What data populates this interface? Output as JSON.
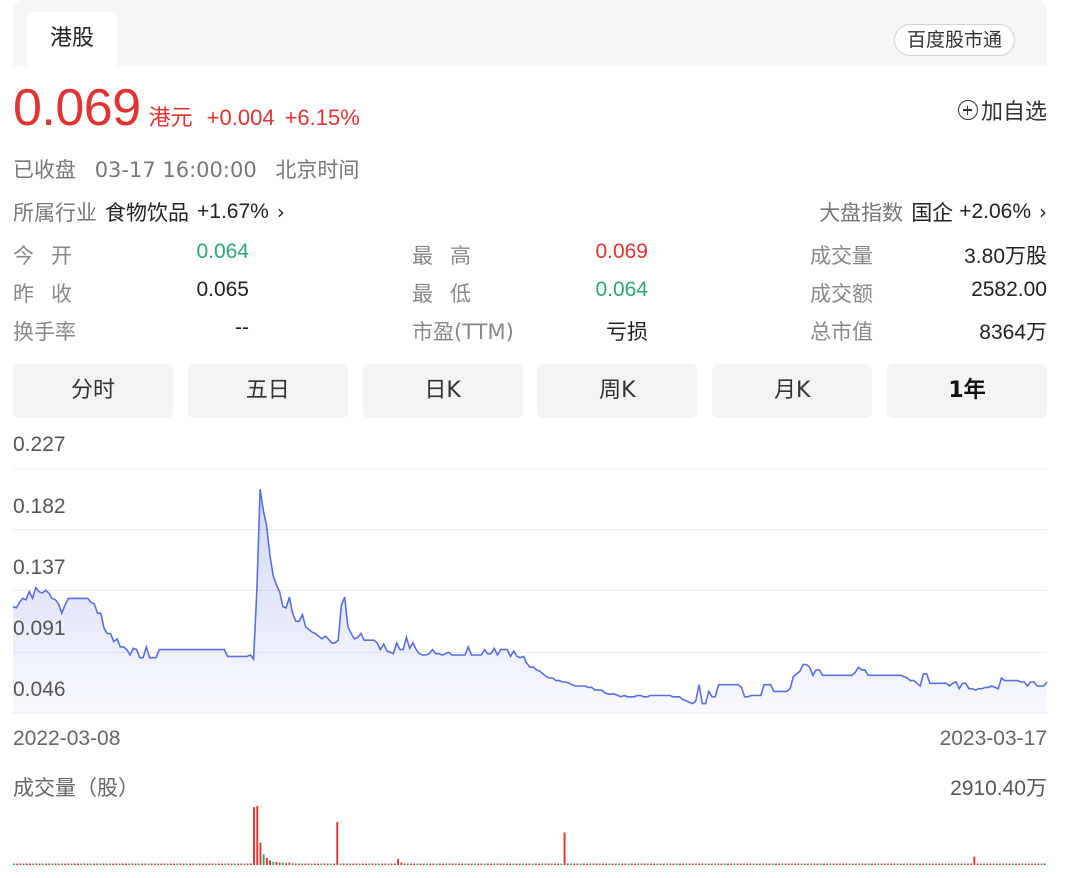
{
  "header": {
    "tab_label": "港股",
    "badge": "百度股市通"
  },
  "quote": {
    "price": "0.069",
    "currency": "港元",
    "change": "+0.004",
    "change_pct": "+6.15%",
    "add_favorite": "加自选",
    "status": "已收盘",
    "datetime": "03-17 16:00:00",
    "timezone": "北京时间"
  },
  "industry": {
    "label": "所属行业",
    "name": "食物饮品",
    "change": "+1.67%"
  },
  "index": {
    "label": "大盘指数",
    "name": "国企",
    "change": "+2.06%"
  },
  "stats": {
    "open": {
      "label": "今开",
      "value": "0.064"
    },
    "high": {
      "label": "最高",
      "value": "0.069"
    },
    "volume": {
      "label": "成交量",
      "value": "3.80万股"
    },
    "prev_close": {
      "label": "昨收",
      "value": "0.065"
    },
    "low": {
      "label": "最低",
      "value": "0.064"
    },
    "turnover": {
      "label": "成交额",
      "value": "2582.00"
    },
    "turnover_rate": {
      "label": "换手率",
      "value": "--"
    },
    "pe": {
      "label": "市盈(TTM)",
      "value": "亏损"
    },
    "market_cap": {
      "label": "总市值",
      "value": "8364万"
    }
  },
  "periods": [
    "分时",
    "五日",
    "日K",
    "周K",
    "月K",
    "1年"
  ],
  "active_period": "1年",
  "colors": {
    "up": "#e33232",
    "down": "#2aa872",
    "line": "#5b6ee1",
    "fill": "#e9ecfb"
  },
  "chart_data": [
    {
      "type": "area",
      "title": "",
      "x_start": "2022-03-08",
      "x_end": "2023-03-17",
      "x_labels": [
        "2022-03-08",
        "2023-03-17"
      ],
      "y_ticks": [
        "0.227",
        "0.182",
        "0.137",
        "0.091",
        "0.046"
      ],
      "ylim": [
        0.046,
        0.227
      ],
      "grid": true,
      "series": [
        {
          "values": [
            0.125,
            0.124,
            0.128,
            0.131,
            0.13,
            0.136,
            0.131,
            0.139,
            0.136,
            0.135,
            0.137,
            0.135,
            0.131,
            0.13,
            0.127,
            0.12,
            0.126,
            0.131,
            0.131,
            0.131,
            0.131,
            0.131,
            0.131,
            0.131,
            0.128,
            0.127,
            0.12,
            0.12,
            0.109,
            0.105,
            0.105,
            0.099,
            0.101,
            0.095,
            0.095,
            0.093,
            0.089,
            0.094,
            0.093,
            0.087,
            0.087,
            0.095,
            0.087,
            0.087,
            0.087,
            0.093,
            0.093,
            0.093,
            0.093,
            0.093,
            0.093,
            0.093,
            0.093,
            0.093,
            0.093,
            0.093,
            0.093,
            0.093,
            0.093,
            0.093,
            0.093,
            0.093,
            0.093,
            0.093,
            0.093,
            0.093,
            0.088,
            0.088,
            0.088,
            0.088,
            0.088,
            0.088,
            0.088,
            0.089,
            0.086,
            0.138,
            0.212,
            0.196,
            0.185,
            0.163,
            0.148,
            0.141,
            0.136,
            0.125,
            0.124,
            0.132,
            0.12,
            0.114,
            0.114,
            0.119,
            0.11,
            0.108,
            0.106,
            0.105,
            0.103,
            0.101,
            0.103,
            0.101,
            0.098,
            0.098,
            0.1,
            0.126,
            0.132,
            0.11,
            0.105,
            0.101,
            0.102,
            0.105,
            0.1,
            0.1,
            0.1,
            0.1,
            0.098,
            0.093,
            0.097,
            0.092,
            0.091,
            0.09,
            0.098,
            0.093,
            0.093,
            0.102,
            0.094,
            0.098,
            0.093,
            0.09,
            0.089,
            0.089,
            0.09,
            0.093,
            0.09,
            0.09,
            0.089,
            0.09,
            0.091,
            0.089,
            0.089,
            0.089,
            0.089,
            0.089,
            0.095,
            0.089,
            0.089,
            0.089,
            0.089,
            0.093,
            0.09,
            0.09,
            0.094,
            0.089,
            0.093,
            0.093,
            0.093,
            0.088,
            0.092,
            0.088,
            0.087,
            0.088,
            0.083,
            0.08,
            0.08,
            0.078,
            0.077,
            0.075,
            0.073,
            0.072,
            0.072,
            0.07,
            0.07,
            0.069,
            0.069,
            0.068,
            0.067,
            0.066,
            0.066,
            0.066,
            0.066,
            0.065,
            0.065,
            0.063,
            0.063,
            0.063,
            0.061,
            0.06,
            0.06,
            0.06,
            0.059,
            0.058,
            0.059,
            0.058,
            0.058,
            0.058,
            0.059,
            0.059,
            0.058,
            0.058,
            0.059,
            0.059,
            0.059,
            0.059,
            0.059,
            0.059,
            0.059,
            0.058,
            0.058,
            0.058,
            0.056,
            0.055,
            0.054,
            0.053,
            0.055,
            0.067,
            0.053,
            0.053,
            0.062,
            0.058,
            0.058,
            0.067,
            0.067,
            0.067,
            0.067,
            0.067,
            0.067,
            0.067,
            0.065,
            0.058,
            0.058,
            0.059,
            0.059,
            0.059,
            0.059,
            0.067,
            0.067,
            0.067,
            0.062,
            0.062,
            0.062,
            0.062,
            0.062,
            0.064,
            0.073,
            0.075,
            0.077,
            0.082,
            0.082,
            0.08,
            0.074,
            0.078,
            0.078,
            0.074,
            0.074,
            0.074,
            0.074,
            0.074,
            0.074,
            0.074,
            0.074,
            0.074,
            0.074,
            0.076,
            0.08,
            0.078,
            0.078,
            0.074,
            0.074,
            0.074,
            0.074,
            0.074,
            0.074,
            0.074,
            0.074,
            0.074,
            0.074,
            0.074,
            0.073,
            0.072,
            0.07,
            0.07,
            0.068,
            0.066,
            0.075,
            0.075,
            0.068,
            0.068,
            0.068,
            0.068,
            0.068,
            0.068,
            0.066,
            0.068,
            0.069,
            0.064,
            0.068,
            0.068,
            0.064,
            0.064,
            0.063,
            0.064,
            0.064,
            0.065,
            0.065,
            0.066,
            0.065,
            0.064,
            0.072,
            0.07,
            0.07,
            0.07,
            0.07,
            0.07,
            0.069,
            0.069,
            0.066,
            0.069,
            0.069,
            0.066,
            0.066,
            0.066,
            0.069
          ]
        }
      ]
    },
    {
      "type": "bar",
      "title": "成交量（股）",
      "max_label": "2910.40万",
      "series": [
        {
          "values": [
            0.01,
            0.02,
            0.02,
            0.01,
            0.01,
            0.02,
            0.01,
            0.01,
            0.02,
            0.02,
            0.02,
            0.02,
            0.01,
            0.02,
            0.01,
            0.02,
            0.02,
            0.02,
            0.02,
            0.01,
            0.02,
            0.01,
            0.01,
            0.01,
            0.01,
            0.02,
            0.02,
            0.01,
            0.01,
            0.02,
            0.02,
            0.02,
            0.02,
            0.02,
            0.01,
            0.02,
            0.02,
            0.01,
            0.02,
            0.02,
            0.01,
            0.01,
            0.01,
            0.02,
            0.01,
            0.02,
            0.01,
            0.02,
            0.02,
            0.02,
            0.02,
            0.02,
            0.02,
            0.02,
            0.02,
            0.02,
            0.01,
            0.02,
            0.02,
            0.01,
            0.01,
            0.02,
            0.01,
            0.01,
            0.02,
            0.02,
            0.01,
            0.01,
            0.02,
            0.01,
            0.01,
            0.02,
            0.01,
            0.02,
            0.01,
            0.98,
            1.0,
            0.38,
            0.18,
            0.12,
            0.08,
            0.05,
            0.05,
            0.04,
            0.04,
            0.03,
            0.04,
            0.03,
            0.02,
            0.02,
            0.02,
            0.02,
            0.02,
            0.02,
            0.02,
            0.02,
            0.02,
            0.02,
            0.01,
            0.02,
            0.02,
            0.02,
            0.02,
            0.01,
            0.01,
            0.01,
            0.02,
            0.02,
            0.01,
            0.02,
            0.02,
            0.02,
            0.01,
            0.01,
            0.01,
            0.02,
            0.02,
            0.02,
            0.02,
            0.02,
            0.02,
            0.04,
            0.02,
            0.02,
            0.02,
            0.02,
            0.02,
            0.02,
            0.02,
            0.02,
            0.02,
            0.02,
            0.02,
            0.02,
            0.02,
            0.01,
            0.02,
            0.02,
            0.02,
            0.02,
            0.02,
            0.02,
            0.01,
            0.01,
            0.01,
            0.02,
            0.02,
            0.02,
            0.01,
            0.02,
            0.02,
            0.02,
            0.02,
            0.02,
            0.02,
            0.02,
            0.02,
            0.02,
            0.02,
            0.02,
            0.02,
            0.02,
            0.02,
            0.02,
            0.02,
            0.02,
            0.02,
            0.02,
            0.02,
            0.02,
            0.02,
            0.02,
            0.02,
            0.01,
            0.02,
            0.02,
            0.02,
            0.02,
            0.02,
            0.02,
            0.02,
            0.02,
            0.02,
            0.02,
            0.02,
            0.02,
            0.02,
            0.02,
            0.02,
            0.02,
            0.02,
            0.02,
            0.02,
            0.02,
            0.02,
            0.02,
            0.02,
            0.02,
            0.02,
            0.02,
            0.02,
            0.02,
            0.02,
            0.02,
            0.02,
            0.02,
            0.02,
            0.02,
            0.02,
            0.02,
            0.02,
            0.02,
            0.02,
            0.02,
            0.02,
            0.02,
            0.02,
            0.02,
            0.02,
            0.02,
            0.02,
            0.02,
            0.02,
            0.02,
            0.02,
            0.02,
            0.02,
            0.02,
            0.02,
            0.02,
            0.02,
            0.02,
            0.02,
            0.02,
            0.02,
            0.02,
            0.02,
            0.02,
            0.02,
            0.02,
            0.02,
            0.02,
            0.02,
            0.02,
            0.02,
            0.02,
            0.02,
            0.02,
            0.02,
            0.02,
            0.02,
            0.02,
            0.02,
            0.02,
            0.02,
            0.02,
            0.02,
            0.02,
            0.02,
            0.02,
            0.02,
            0.02,
            0.02,
            0.02,
            0.02,
            0.02,
            0.02,
            0.02,
            0.02,
            0.02,
            0.02,
            0.02,
            0.02,
            0.02,
            0.02,
            0.02,
            0.02,
            0.02,
            0.02,
            0.02,
            0.02,
            0.02,
            0.02,
            0.02,
            0.02,
            0.02,
            0.02,
            0.02,
            0.02,
            0.02,
            0.02,
            0.02,
            0.02,
            0.02,
            0.02,
            0.02,
            0.02,
            0.02,
            0.02,
            0.02,
            0.02,
            0.02,
            0.02,
            0.02,
            0.02,
            0.02,
            0.02,
            0.02,
            0.02,
            0.02,
            0.02,
            0.02,
            0.02,
            0.02,
            0.02,
            0.02,
            0.02,
            0.02,
            0.02,
            0.02,
            0.02,
            0.02,
            0.02
          ],
          "spikes": [
            {
              "index": 75,
              "value": 0.98,
              "dir": "up"
            },
            {
              "index": 76,
              "value": 1.0,
              "dir": "up"
            },
            {
              "index": 101,
              "value": 0.73,
              "dir": "up"
            },
            {
              "index": 120,
              "value": 0.1,
              "dir": "up"
            },
            {
              "index": 172,
              "value": 0.55,
              "dir": "up"
            },
            {
              "index": 300,
              "value": 0.14,
              "dir": "up"
            }
          ]
        }
      ]
    }
  ]
}
